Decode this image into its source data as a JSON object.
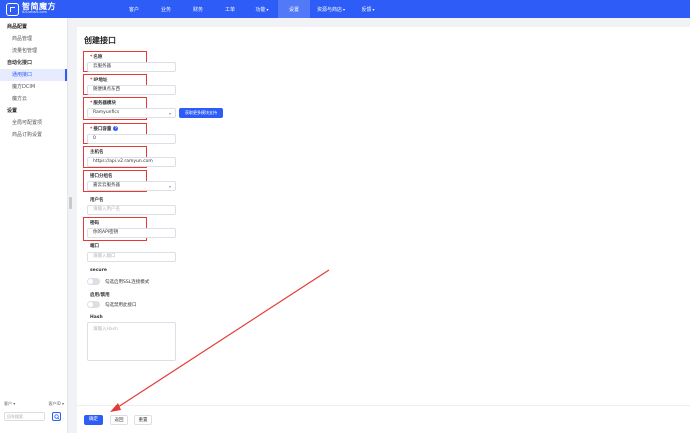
{
  "app": {
    "logo_cn": "智简魔方",
    "logo_en": "IDCsmart.com"
  },
  "top_nav": [
    {
      "label": "客户"
    },
    {
      "label": "业务"
    },
    {
      "label": "财务"
    },
    {
      "label": "工单"
    },
    {
      "label": "功能",
      "caret": "▾"
    },
    {
      "label": "设置"
    },
    {
      "label": "资源与商店",
      "caret": "▾"
    },
    {
      "label": "反馈",
      "caret": "▾"
    }
  ],
  "sidebar": {
    "groups": [
      {
        "title": "商品配置",
        "items": [
          "商品管理",
          "流量包管理"
        ]
      },
      {
        "title": "自动化接口",
        "items": [
          "通用接口",
          "魔方DCIM",
          "魔方云"
        ]
      },
      {
        "title": "设置",
        "items": [
          "全局可配置项",
          "商品订购设置"
        ]
      }
    ],
    "bottom": {
      "left_select": "客户",
      "right_select": "客户ID",
      "search_placeholder": "回车搜索"
    }
  },
  "form": {
    "title": "创建接口",
    "fields": {
      "name": {
        "label": "名称",
        "value": "云服务器"
      },
      "ip": {
        "label": "IP地址",
        "value": "随便填点东西"
      },
      "module": {
        "label": "服务器模块",
        "value": "Ramyunfics"
      },
      "max_accounts": {
        "label": "接口容量",
        "value": "0"
      },
      "hostname": {
        "label": "主机名",
        "value": "https://api.v2.ramyun.com"
      },
      "group": {
        "label": "接口分组名",
        "value": "嘉云云服务器"
      },
      "username": {
        "label": "用户名",
        "placeholder": "请输入用户名"
      },
      "password": {
        "label": "密码",
        "value": "你的API密钥"
      },
      "port": {
        "label": "端口",
        "placeholder": "请输入端口"
      },
      "secure": {
        "label": "secure",
        "toggle_text": "勾选启用SSL连接模式"
      },
      "disabled": {
        "label": "启用/禁用",
        "toggle_text": "勾选禁用此接口"
      },
      "hash": {
        "label": "Hash",
        "placeholder": "请输入Hash"
      }
    },
    "get_more_modules": "获取更多模块支持"
  },
  "actions": {
    "confirm": "确定",
    "back": "返回",
    "reset": "重置"
  },
  "colors": {
    "brand": "#2d5cf6",
    "highlight": "#e53935",
    "arrow": "#e53935"
  }
}
